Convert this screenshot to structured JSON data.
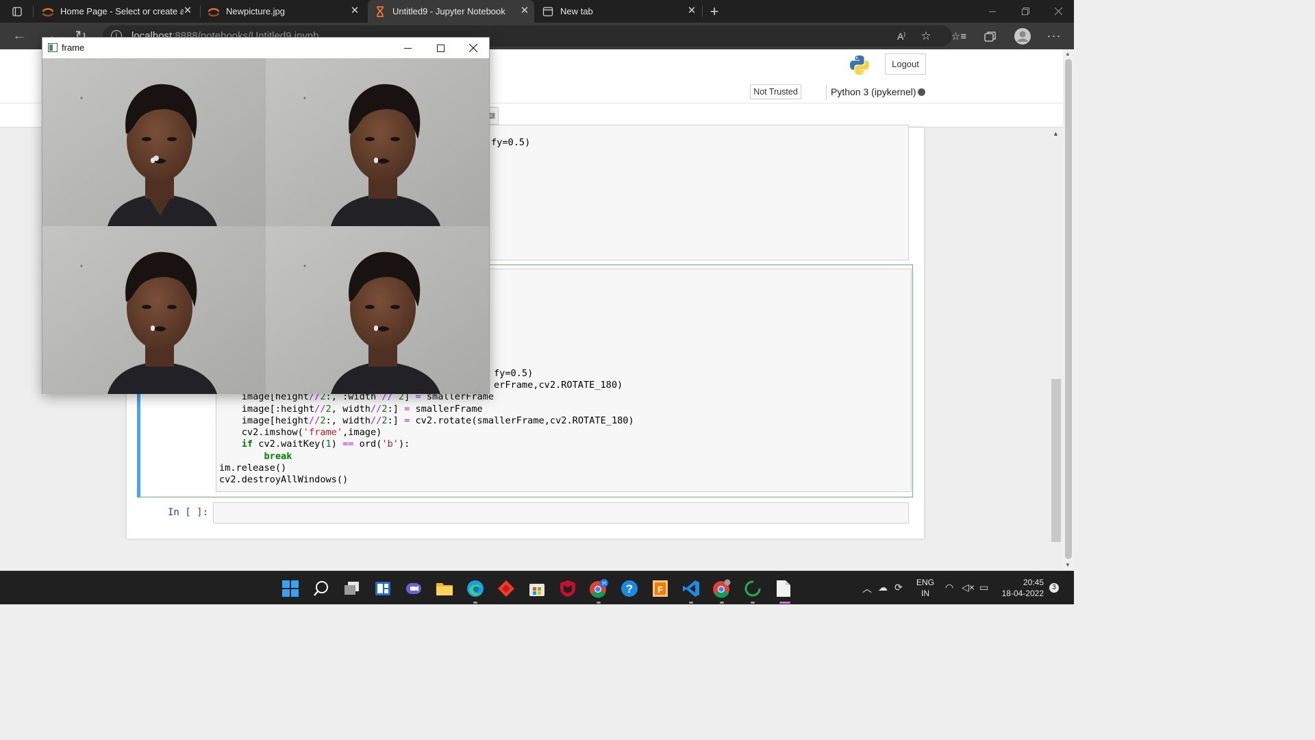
{
  "browser": {
    "tabs": [
      {
        "label": "Home Page - Select or create a n",
        "favicon": "jupyter-icon",
        "active": false
      },
      {
        "label": "Newpicture.jpg",
        "favicon": "jupyter-icon",
        "active": false
      },
      {
        "label": "Untitled9 - Jupyter Notebook",
        "favicon": "hourglass-icon",
        "active": true
      },
      {
        "label": "New tab",
        "favicon": "new-tab-icon",
        "active": false
      }
    ],
    "url_host": "localhost",
    "url_rest": ":8888/notebooks/Untitled9.ipynb"
  },
  "jupyter": {
    "logout_label": "Logout",
    "trust_label": "Not Trusted",
    "kernel_label": "Python 3 (ipykernel)",
    "empty_prompt": "In [ ]:"
  },
  "code": {
    "cell1_visible": "fy=0.5)",
    "cell2_line_fy": "fy=0.5)",
    "cell2_line_rotate_tail": "erFrame,cv2.ROTATE_180)",
    "lines": [
      {
        "indent": "    ",
        "text": "image[height//2:, :width // 2] = smallerFrame"
      },
      {
        "indent": "    ",
        "text": "image[:height//2, width//2:] = smallerFrame"
      },
      {
        "indent": "    ",
        "text": "image[height//2:, width//2:] = cv2.rotate(smallerFrame,cv2.ROTATE_180)"
      },
      {
        "indent": "    ",
        "text": "cv2.imshow('frame',image)"
      },
      {
        "indent": "    ",
        "text": "if cv2.waitKey(1) == ord('b'):"
      },
      {
        "indent": "        ",
        "text": "break"
      },
      {
        "indent": "",
        "text": "im.release()"
      },
      {
        "indent": "",
        "text": "cv2.destroyAllWindows()"
      }
    ]
  },
  "cv_window": {
    "title": "frame"
  },
  "taskbar": {
    "language_top": "ENG",
    "language_bottom": "IN",
    "time": "20:45",
    "date": "18-04-2022",
    "notification_count": "3"
  },
  "colors": {
    "accent_blue": "#42a5f5",
    "cell_border_green": "#66bb6a",
    "prompt_blue": "#303f9f"
  }
}
